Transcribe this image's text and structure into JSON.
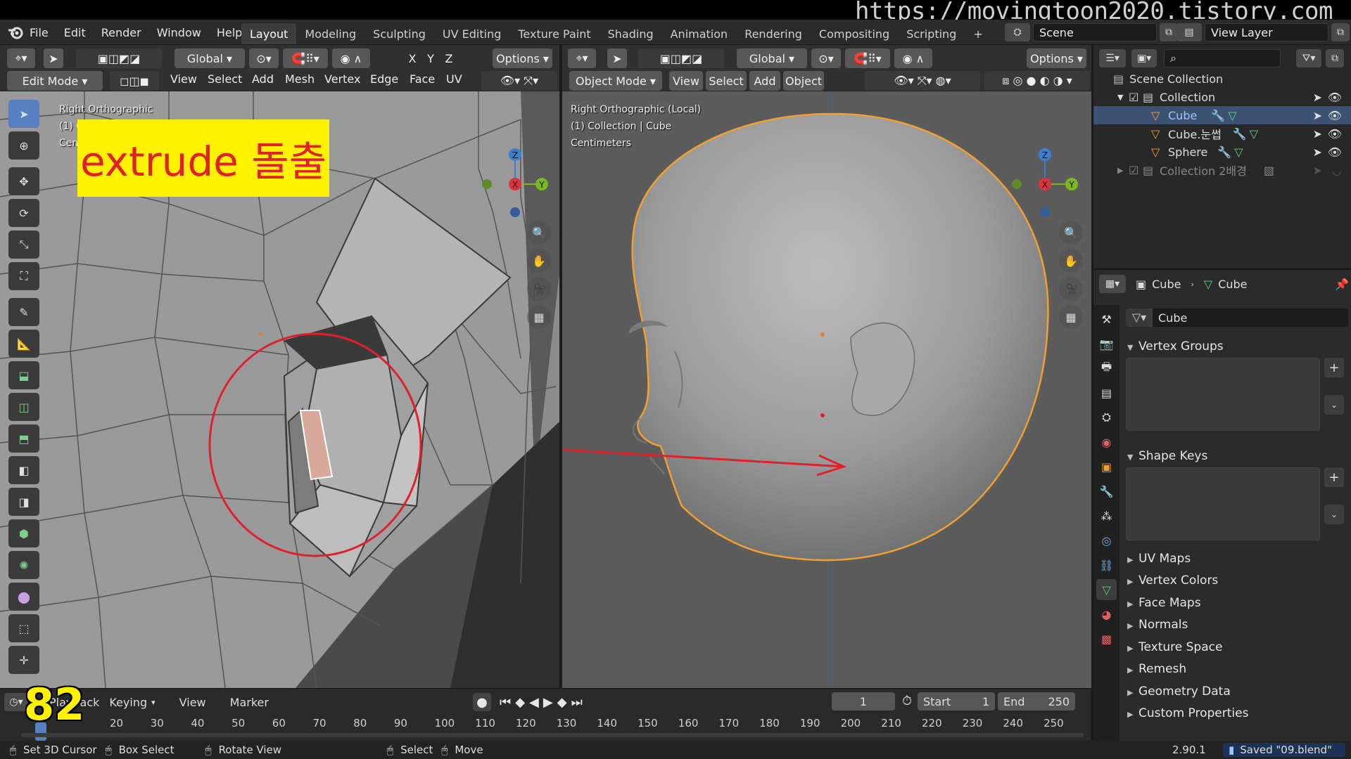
{
  "watermark": "https://movingtoon2020.tistory.com",
  "menu": [
    "File",
    "Edit",
    "Render",
    "Window",
    "Help"
  ],
  "workspaces": [
    "Layout",
    "Modeling",
    "Sculpting",
    "UV Editing",
    "Texture Paint",
    "Shading",
    "Animation",
    "Rendering",
    "Compositing",
    "Scripting"
  ],
  "workspace_add": "+",
  "scene": {
    "label": "Scene",
    "view_layer": "View Layer"
  },
  "left_viewport": {
    "transform": "Global",
    "axes": [
      "X",
      "Y",
      "Z"
    ],
    "options": "Options",
    "mode": "Edit Mode",
    "menus": [
      "View",
      "Select",
      "Add",
      "Mesh",
      "Vertex",
      "Edge",
      "Face",
      "UV"
    ],
    "overlay_lines": [
      "Right Orthographic",
      "(1) C",
      "Cen"
    ],
    "caption": "extrude 돌출"
  },
  "right_viewport": {
    "transform": "Global",
    "options": "Options",
    "mode": "Object Mode",
    "menus": [
      "View",
      "Select",
      "Add",
      "Object"
    ],
    "overlay_lines": [
      "Right Orthographic (Local)",
      "(1) Collection | Cube",
      "Centimeters"
    ]
  },
  "gizmo": {
    "x": "X",
    "y": "Y",
    "z": "Z"
  },
  "outliner": {
    "search_icon": "search-icon",
    "root": "Scene Collection",
    "items": [
      {
        "label": "Collection"
      },
      {
        "label": "Cube"
      },
      {
        "label": "Cube.눈썹"
      },
      {
        "label": "Sphere"
      },
      {
        "label": "Collection 2배경"
      }
    ]
  },
  "properties": {
    "breadcrumb": [
      "Cube",
      "Cube"
    ],
    "data_name": "Cube",
    "vertex_groups": "Vertex Groups",
    "shape_keys": "Shape Keys",
    "collapsed": [
      "UV Maps",
      "Vertex Colors",
      "Face Maps",
      "Normals",
      "Texture Space",
      "Remesh",
      "Geometry Data",
      "Custom Properties"
    ],
    "add": "+",
    "remove": "−"
  },
  "timeline": {
    "episode_number": "82",
    "playback": "Playback",
    "keying": "Keying",
    "menus": [
      "View",
      "Marker"
    ],
    "current_frame": "1",
    "start_label": "Start",
    "start": "1",
    "end_label": "End",
    "end": "250",
    "ruler": [
      "20",
      "30",
      "40",
      "50",
      "60",
      "70",
      "80",
      "90",
      "100",
      "110",
      "120",
      "130",
      "140",
      "150",
      "160",
      "170",
      "180",
      "190",
      "200",
      "210",
      "220",
      "230",
      "240",
      "250"
    ]
  },
  "status": {
    "items": [
      "Set 3D Cursor",
      "Box Select",
      "Rotate View",
      "Select",
      "Move"
    ],
    "version": "2.90.1",
    "saved": "Saved \"09.blend\""
  },
  "colors": {
    "accent": "#5680c2",
    "selection_orange": "#f0a030",
    "annotation_red": "#e0202a",
    "caption_bg": "#fff200"
  }
}
